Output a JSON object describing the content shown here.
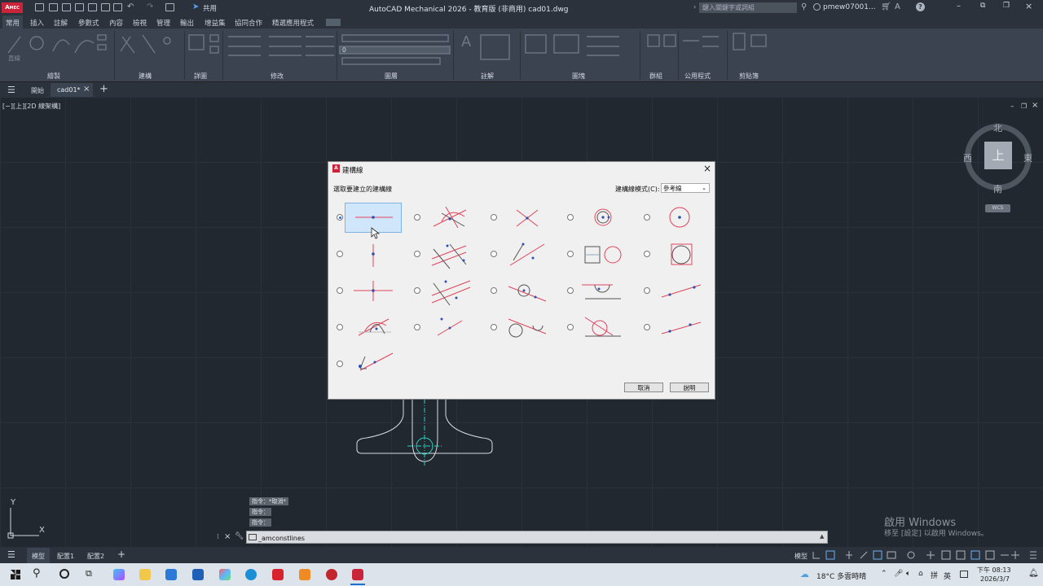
{
  "window": {
    "app_logo": "A",
    "app_logo_sub": "MEC",
    "title": "AutoCAD Mechanical 2026 - 教育版 (非商用)    cad01.dwg",
    "share_label": "共用",
    "search_placeholder": "鍵入關鍵字或詞組",
    "user": "pmew07001..."
  },
  "ribbon": {
    "tabs": [
      "常用",
      "插入",
      "註解",
      "參數式",
      "內容",
      "檢視",
      "管理",
      "輸出",
      "增益集",
      "協同合作",
      "精選應用程式"
    ],
    "panels": [
      "繪製",
      "建構",
      "詳圖",
      "修改",
      "圖層",
      "註解",
      "圖塊",
      "群組",
      "公用程式",
      "剪貼簿"
    ],
    "items": {
      "line": "直線",
      "layer_value": "0"
    }
  },
  "doc_tabs": {
    "start": "開始",
    "active": "cad01*",
    "add": "+"
  },
  "viewport": {
    "label": "[−][上][2D 線架構]"
  },
  "viewcube": {
    "north": "北",
    "south": "南",
    "east": "東",
    "west": "西",
    "face": "上",
    "wcs": "WCS"
  },
  "ucs": {
    "x": "X",
    "y": "Y"
  },
  "dialog": {
    "title": "建構線",
    "close": "×",
    "prompt": "選取要建立的建構線",
    "mode_label": "建構線模式(C):",
    "mode_value": "參考線",
    "cancel": "取消",
    "help": "說明",
    "selected_index": 0
  },
  "command": {
    "history": [
      "指令：*取消*",
      "指令：",
      "指令："
    ],
    "current": "_amconstlines"
  },
  "activation": {
    "line1": "啟用 Windows",
    "line2": "移至 [設定] 以啟用 Windows。"
  },
  "layout_tabs": {
    "model": "模型",
    "layout1": "配置1",
    "layout2": "配置2",
    "add": "+"
  },
  "status": {
    "model": "模型"
  },
  "taskbar": {
    "weather": "18°C 多雲時晴",
    "lang": "英",
    "time": "下午 08:13",
    "date": "2026/3/7"
  },
  "colors": {
    "accent_red": "#e0445c",
    "dot_blue": "#2c4fb0",
    "titlebar": "#2b323c",
    "ribbon": "#3b4350",
    "canvas": "#212830"
  }
}
